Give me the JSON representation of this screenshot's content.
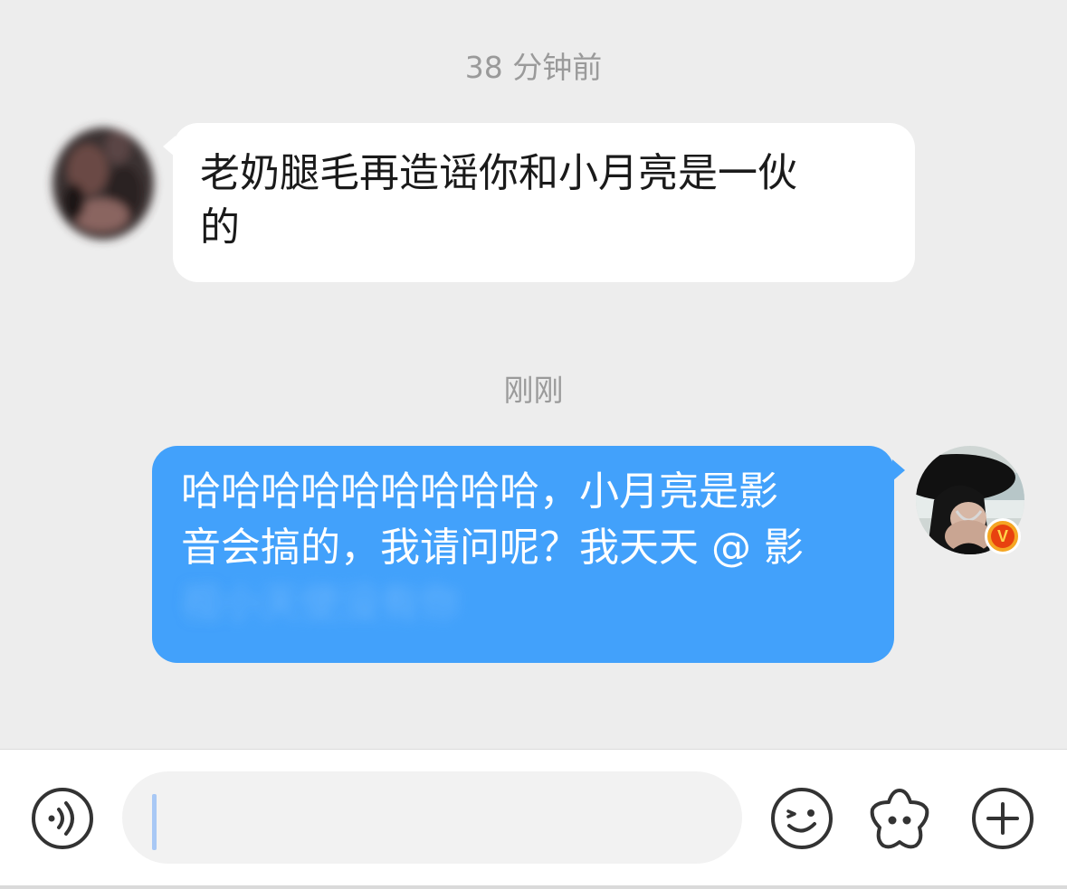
{
  "conversation": {
    "messages": [
      {
        "timestamp": "38 分钟前",
        "direction": "incoming",
        "line1": "老奶腿毛再造谣你和小月亮是一伙",
        "line2": "的"
      },
      {
        "timestamp": "刚刚",
        "direction": "outgoing",
        "line1": "哈哈哈哈哈哈哈哈哈，小月亮是影",
        "line2": "音会搞的，我请问呢？我天天 @ 影",
        "line3_blurred": "视小天使没有你"
      }
    ],
    "verified_badge": "V"
  },
  "composer": {
    "input_value": "",
    "voice_icon": "voice-input-icon",
    "emoji_icon": "emoji-icon",
    "sticker_icon": "sticker-icon",
    "plus_icon": "plus-icon"
  },
  "colors": {
    "chat_background": "#ededed",
    "incoming_bubble": "#ffffff",
    "outgoing_bubble": "#42a1fb",
    "timestamp_text": "#9a9a9a",
    "toolbar_icon": "#333333"
  }
}
